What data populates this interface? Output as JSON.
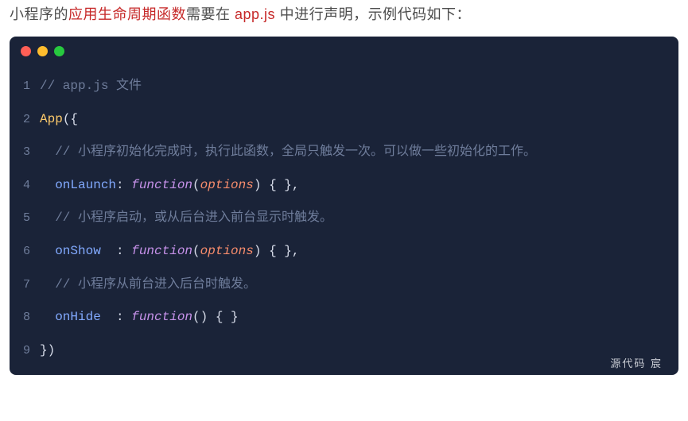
{
  "intro": {
    "pre": "小程序的",
    "hl1": "应用生命周期函数",
    "mid": "需要在 ",
    "hl2": "app.js",
    "post": " 中进行声明，示例代码如下："
  },
  "window": {
    "dots": [
      "red",
      "yellow",
      "green"
    ]
  },
  "code": {
    "lines": [
      {
        "n": "1",
        "tokens": [
          {
            "cls": "tok-comment",
            "t": "// app.js 文件"
          }
        ]
      },
      {
        "n": "2",
        "tokens": [
          {
            "cls": "tok-func",
            "t": "App"
          },
          {
            "cls": "tok-punc",
            "t": "({"
          }
        ]
      },
      {
        "n": "3",
        "tokens": [
          {
            "cls": "",
            "t": "  "
          },
          {
            "cls": "tok-comment",
            "t": "// 小程序初始化完成时，执行此函数，全局只触发一次。可以做一些初始化的工作。"
          }
        ]
      },
      {
        "n": "4",
        "tokens": [
          {
            "cls": "",
            "t": "  "
          },
          {
            "cls": "tok-prop",
            "t": "onLaunch"
          },
          {
            "cls": "tok-punc",
            "t": ": "
          },
          {
            "cls": "tok-keyword",
            "t": "function"
          },
          {
            "cls": "tok-punc",
            "t": "("
          },
          {
            "cls": "tok-param",
            "t": "options"
          },
          {
            "cls": "tok-punc",
            "t": ") { },"
          }
        ]
      },
      {
        "n": "5",
        "tokens": [
          {
            "cls": "",
            "t": "  "
          },
          {
            "cls": "tok-comment",
            "t": "// 小程序启动，或从后台进入前台显示时触发。"
          }
        ]
      },
      {
        "n": "6",
        "tokens": [
          {
            "cls": "",
            "t": "  "
          },
          {
            "cls": "tok-prop",
            "t": "onShow"
          },
          {
            "cls": "tok-punc",
            "t": "  : "
          },
          {
            "cls": "tok-keyword",
            "t": "function"
          },
          {
            "cls": "tok-punc",
            "t": "("
          },
          {
            "cls": "tok-param",
            "t": "options"
          },
          {
            "cls": "tok-punc",
            "t": ") { },"
          }
        ]
      },
      {
        "n": "7",
        "tokens": [
          {
            "cls": "",
            "t": "  "
          },
          {
            "cls": "tok-comment",
            "t": "// 小程序从前台进入后台时触发。"
          }
        ]
      },
      {
        "n": "8",
        "tokens": [
          {
            "cls": "",
            "t": "  "
          },
          {
            "cls": "tok-prop",
            "t": "onHide"
          },
          {
            "cls": "tok-punc",
            "t": "  : "
          },
          {
            "cls": "tok-keyword",
            "t": "function"
          },
          {
            "cls": "tok-punc",
            "t": "() { }"
          }
        ]
      },
      {
        "n": "9",
        "tokens": [
          {
            "cls": "tok-punc",
            "t": "})"
          }
        ]
      }
    ]
  },
  "watermark": "源代码  宸"
}
